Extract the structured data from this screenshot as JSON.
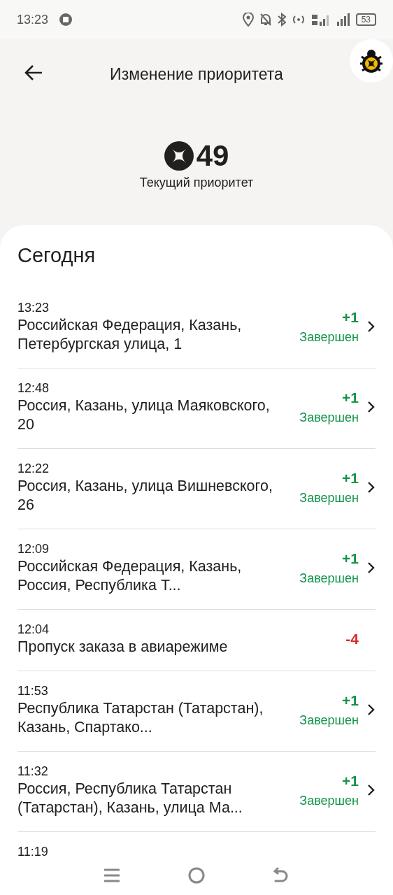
{
  "status_bar": {
    "time": "13:23",
    "battery": "53"
  },
  "header": {
    "title": "Изменение приоритета"
  },
  "priority": {
    "value": "49",
    "label": "Текущий приоритет"
  },
  "section": {
    "title": "Сегодня"
  },
  "entries": [
    {
      "kind": "completed",
      "time": "13:23",
      "address": "Российская Федерация, Казань, Петербургская улица, 1",
      "delta": "+1",
      "status": "Завершен"
    },
    {
      "kind": "completed",
      "time": "12:48",
      "address": "Россия, Казань, улица Маяковского, 20",
      "delta": "+1",
      "status": "Завершен"
    },
    {
      "kind": "completed",
      "time": "12:22",
      "address": "Россия, Казань, улица Вишневского, 26",
      "delta": "+1",
      "status": "Завершен"
    },
    {
      "kind": "completed",
      "time": "12:09",
      "address": "Российская Федерация, Казань, Россия, Республика Т...",
      "delta": "+1",
      "status": "Завершен"
    },
    {
      "kind": "penalty",
      "time": "12:04",
      "address": "Пропуск заказа в авиарежиме",
      "delta": "-4"
    },
    {
      "kind": "completed",
      "time": "11:53",
      "address": "Республика Татарстан (Татарстан), Казань, Спартако...",
      "delta": "+1",
      "status": "Завершен"
    },
    {
      "kind": "completed",
      "time": "11:32",
      "address": "Россия, Республика Татарстан (Татарстан), Казань, улица Ма...",
      "delta": "+1",
      "status": "Завершен"
    },
    {
      "kind": "partial",
      "time": "11:19"
    }
  ]
}
